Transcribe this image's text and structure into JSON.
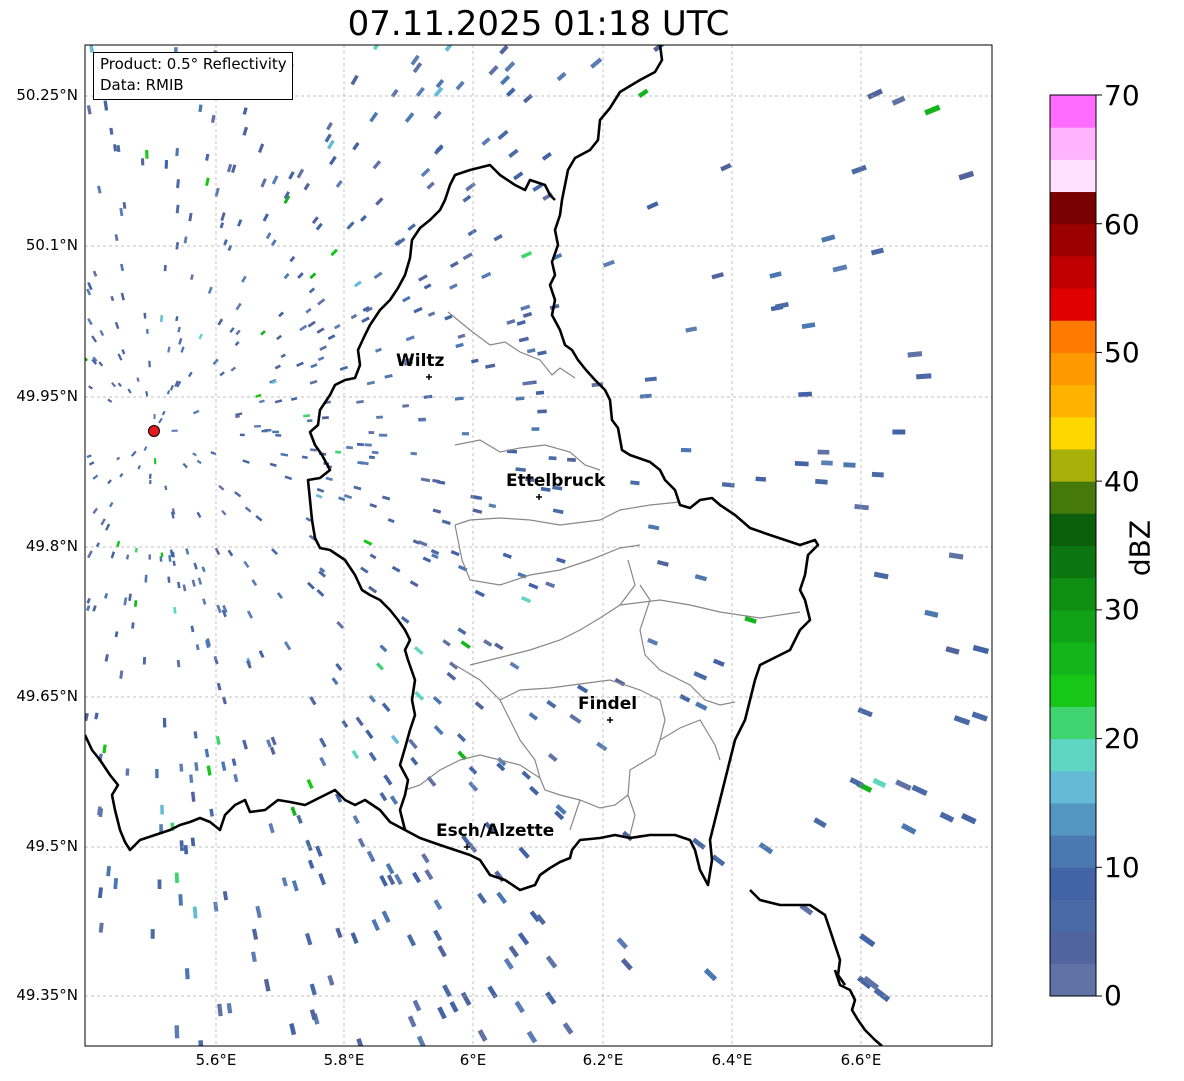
{
  "title": "07.11.2025 01:18 UTC",
  "info_box": {
    "product": "Product: 0.5° Reflectivity",
    "data_source": "Data: RMIB"
  },
  "latitude_labels": [
    "50.25°N",
    "50.1°N",
    "49.95°N",
    "49.8°N",
    "49.65°N",
    "49.5°N",
    "49.35°N"
  ],
  "longitude_labels": [
    "5.6°E",
    "5.8°E",
    "6°E",
    "6.2°E",
    "6.4°E",
    "6.6°E"
  ],
  "cities": [
    {
      "name": "Wiltz"
    },
    {
      "name": "Ettelbruck"
    },
    {
      "name": "Findel"
    },
    {
      "name": "Esch/Alzette"
    }
  ],
  "radar_site": {
    "marker_color": "#e41a1c"
  },
  "colorbar": {
    "label": "dBZ",
    "ticks": [
      "70",
      "60",
      "50",
      "40",
      "30",
      "20",
      "10",
      "0"
    ],
    "range": [
      0,
      70
    ],
    "step": 2.5,
    "colors": [
      "#6173a6",
      "#51649d",
      "#4a6aa5",
      "#4263a5",
      "#4b78b1",
      "#5296c1",
      "#63bbd6",
      "#5fd6c1",
      "#3fd46f",
      "#17c717",
      "#14b51a",
      "#12a218",
      "#0f8e13",
      "#0b7510",
      "#0b5e0b",
      "#457a0b",
      "#a8b00a",
      "#ffd700",
      "#ffb300",
      "#ff9900",
      "#ff7a00",
      "#e10000",
      "#c00000",
      "#9c0000",
      "#780000",
      "#ffe0ff",
      "#ffb3ff",
      "#ff6cff",
      "#ee38ee"
    ]
  }
}
